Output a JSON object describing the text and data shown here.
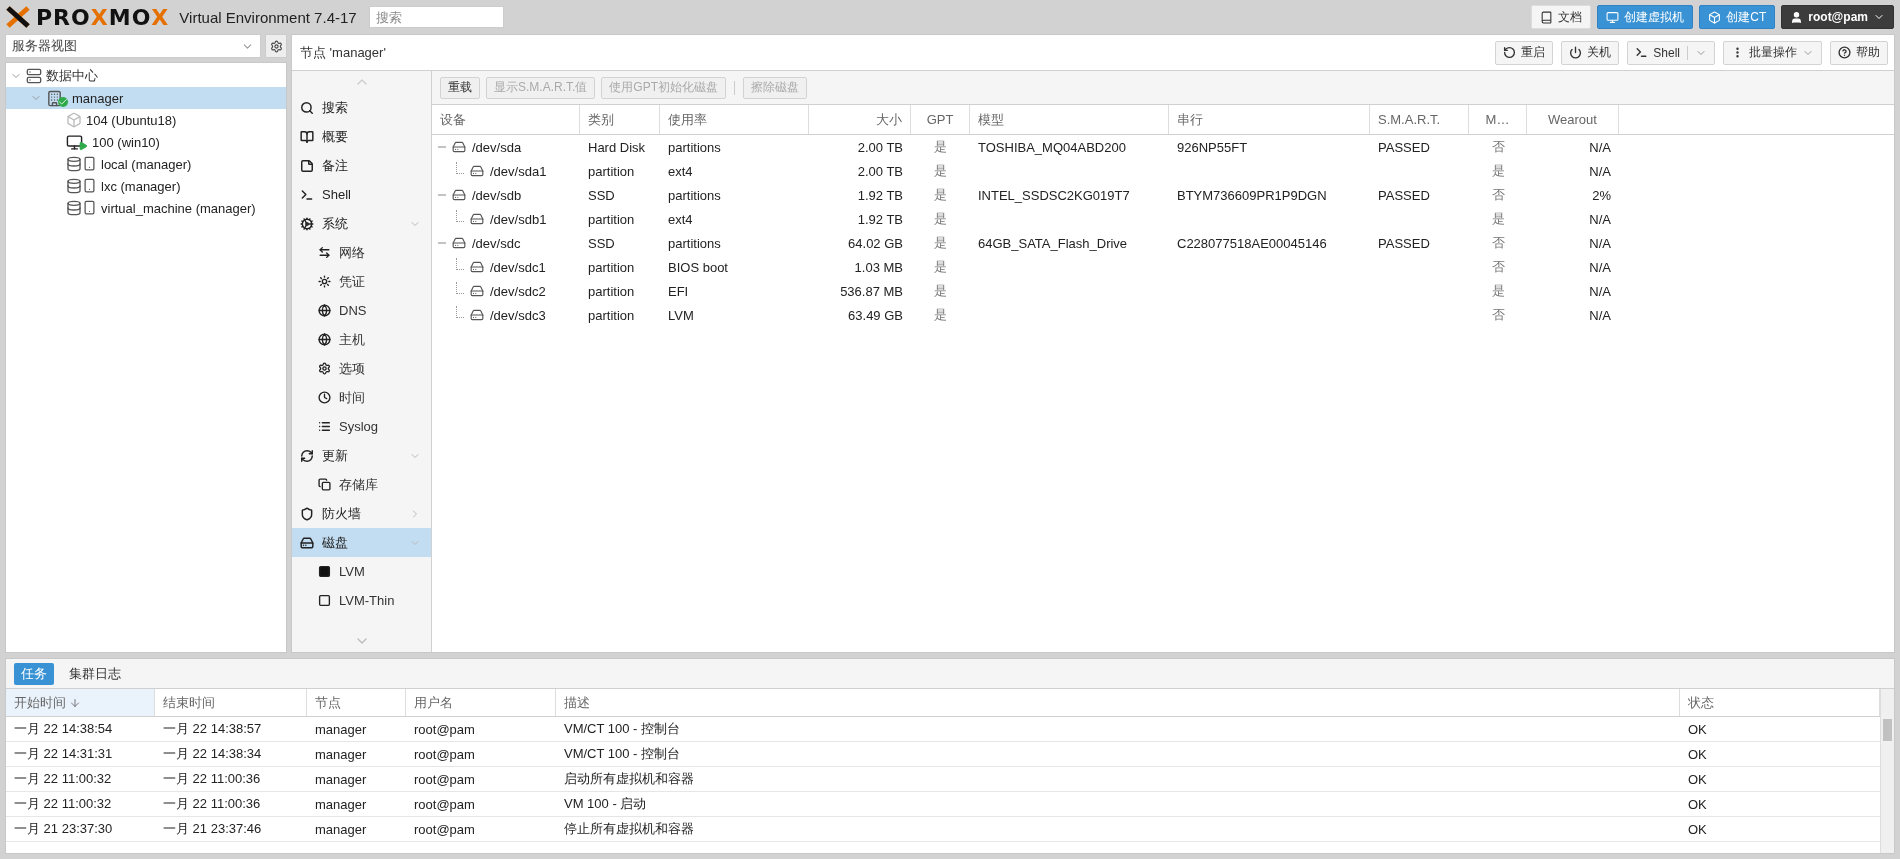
{
  "header": {
    "logo": [
      {
        "text": "PRO",
        "accent": false
      },
      {
        "text": "X",
        "accent": true
      },
      {
        "text": "MO",
        "accent": false
      },
      {
        "text": "X",
        "accent": true
      }
    ],
    "version": "Virtual Environment 7.4-17",
    "search": {
      "placeholder": "搜索"
    },
    "buttons": [
      {
        "label": "文档",
        "kind": "plain"
      },
      {
        "label": "创建虚拟机",
        "kind": "primary"
      },
      {
        "label": "创建CT",
        "kind": "primary"
      }
    ],
    "user": "root@pam"
  },
  "sidebar": {
    "view": "服务器视图",
    "tree": [
      {
        "label": "数据中心",
        "kind": "datacenter",
        "selected": false,
        "expanded": true,
        "children": [
          {
            "label": "manager",
            "kind": "node",
            "selected": true,
            "expanded": true,
            "children": [
              {
                "label": "104 (Ubuntu18)",
                "kind": "container",
                "selected": false,
                "running": false
              },
              {
                "label": "100 (win10)",
                "kind": "vm",
                "selected": false,
                "running": true
              },
              {
                "label": "local (manager)",
                "kind": "storage",
                "selected": false
              },
              {
                "label": "lxc (manager)",
                "kind": "storage",
                "selected": false
              },
              {
                "label": "virtual_machine (manager)",
                "kind": "storage",
                "selected": false
              }
            ]
          }
        ]
      }
    ]
  },
  "node": {
    "title": "节点 'manager'",
    "buttons": [
      {
        "label": "重启",
        "kind": "plain"
      },
      {
        "label": "关机",
        "kind": "plain"
      },
      {
        "label": "Shell",
        "kind": "split"
      },
      {
        "label": "批量操作",
        "kind": "menu"
      },
      {
        "label": "帮助",
        "kind": "plain"
      }
    ],
    "nav": [
      {
        "label": "搜索",
        "selected": false
      },
      {
        "label": "概要",
        "selected": false
      },
      {
        "label": "备注",
        "selected": false
      },
      {
        "label": "Shell",
        "selected": false
      },
      {
        "label": "系统",
        "selected": false,
        "expanded": true,
        "children": [
          {
            "label": "网络",
            "selected": false
          },
          {
            "label": "凭证",
            "selected": false
          },
          {
            "label": "DNS",
            "selected": false
          },
          {
            "label": "主机",
            "selected": false
          },
          {
            "label": "选项",
            "selected": false
          },
          {
            "label": "时间",
            "selected": false
          },
          {
            "label": "Syslog",
            "selected": false
          }
        ]
      },
      {
        "label": "更新",
        "selected": false,
        "expanded": true,
        "children": [
          {
            "label": "存储库",
            "selected": false
          }
        ]
      },
      {
        "label": "防火墙",
        "selected": false,
        "expanded": false
      },
      {
        "label": "磁盘",
        "selected": true,
        "expanded": true,
        "children": [
          {
            "label": "LVM",
            "selected": false
          },
          {
            "label": "LVM-Thin",
            "selected": false
          }
        ]
      }
    ],
    "toolbar": [
      {
        "label": "重载",
        "disabled": false
      },
      {
        "label": "显示S.M.A.R.T.值",
        "disabled": true
      },
      {
        "label": "使用GPT初始化磁盘",
        "disabled": true
      },
      {
        "label": "擦除磁盘",
        "disabled": true
      }
    ],
    "disks": {
      "columns": [
        "设备",
        "类别",
        "使用率",
        "大小",
        "GPT",
        "模型",
        "串行",
        "S.M.A.R.T.",
        "M…",
        "Wearout"
      ],
      "rows": [
        {
          "device": "/dev/sda",
          "type": "Hard Disk",
          "usage": "partitions",
          "size": "2.00 TB",
          "gpt": "是",
          "model": "TOSHIBA_MQ04ABD200",
          "serial": "926NP55FT",
          "smart": "PASSED",
          "mounted": "否",
          "wearout": "N/A",
          "expanded": true,
          "children": [
            {
              "device": "/dev/sda1",
              "type": "partition",
              "usage": "ext4",
              "size": "2.00 TB",
              "gpt": "是",
              "mounted": "是",
              "wearout": "N/A"
            }
          ]
        },
        {
          "device": "/dev/sdb",
          "type": "SSD",
          "usage": "partitions",
          "size": "1.92 TB",
          "gpt": "是",
          "model": "INTEL_SSDSC2KG019T7",
          "serial": "BTYM736609PR1P9DGN",
          "smart": "PASSED",
          "mounted": "否",
          "wearout": "2%",
          "expanded": true,
          "children": [
            {
              "device": "/dev/sdb1",
              "type": "partition",
              "usage": "ext4",
              "size": "1.92 TB",
              "gpt": "是",
              "mounted": "是",
              "wearout": "N/A"
            }
          ]
        },
        {
          "device": "/dev/sdc",
          "type": "SSD",
          "usage": "partitions",
          "size": "64.02 GB",
          "gpt": "是",
          "model": "64GB_SATA_Flash_Drive",
          "serial": "C228077518AE00045146",
          "smart": "PASSED",
          "mounted": "否",
          "wearout": "N/A",
          "expanded": true,
          "children": [
            {
              "device": "/dev/sdc1",
              "type": "partition",
              "usage": "BIOS boot",
              "size": "1.03 MB",
              "gpt": "是",
              "mounted": "否",
              "wearout": "N/A"
            },
            {
              "device": "/dev/sdc2",
              "type": "partition",
              "usage": "EFI",
              "size": "536.87 MB",
              "gpt": "是",
              "mounted": "是",
              "wearout": "N/A"
            },
            {
              "device": "/dev/sdc3",
              "type": "partition",
              "usage": "LVM",
              "size": "63.49 GB",
              "gpt": "是",
              "mounted": "否",
              "wearout": "N/A"
            }
          ]
        }
      ]
    }
  },
  "log": {
    "tabs": [
      {
        "label": "任务",
        "selected": true
      },
      {
        "label": "集群日志",
        "selected": false
      }
    ],
    "columns": [
      {
        "label": "开始时间",
        "sorted": true
      },
      {
        "label": "结束时间",
        "sorted": false
      },
      {
        "label": "节点",
        "sorted": false
      },
      {
        "label": "用户名",
        "sorted": false
      },
      {
        "label": "描述",
        "sorted": false
      },
      {
        "label": "状态",
        "sorted": false
      }
    ],
    "rows": [
      [
        "一月 22 14:38:54",
        "一月 22 14:38:57",
        "manager",
        "root@pam",
        "VM/CT 100 - 控制台",
        "OK"
      ],
      [
        "一月 22 14:31:31",
        "一月 22 14:38:34",
        "manager",
        "root@pam",
        "VM/CT 100 - 控制台",
        "OK"
      ],
      [
        "一月 22 11:00:32",
        "一月 22 11:00:36",
        "manager",
        "root@pam",
        "启动所有虚拟机和容器",
        "OK"
      ],
      [
        "一月 22 11:00:32",
        "一月 22 11:00:36",
        "manager",
        "root@pam",
        "VM 100 - 启动",
        "OK"
      ],
      [
        "一月 21 23:37:30",
        "一月 21 23:37:46",
        "manager",
        "root@pam",
        "停止所有虚拟机和容器",
        "OK"
      ]
    ]
  }
}
